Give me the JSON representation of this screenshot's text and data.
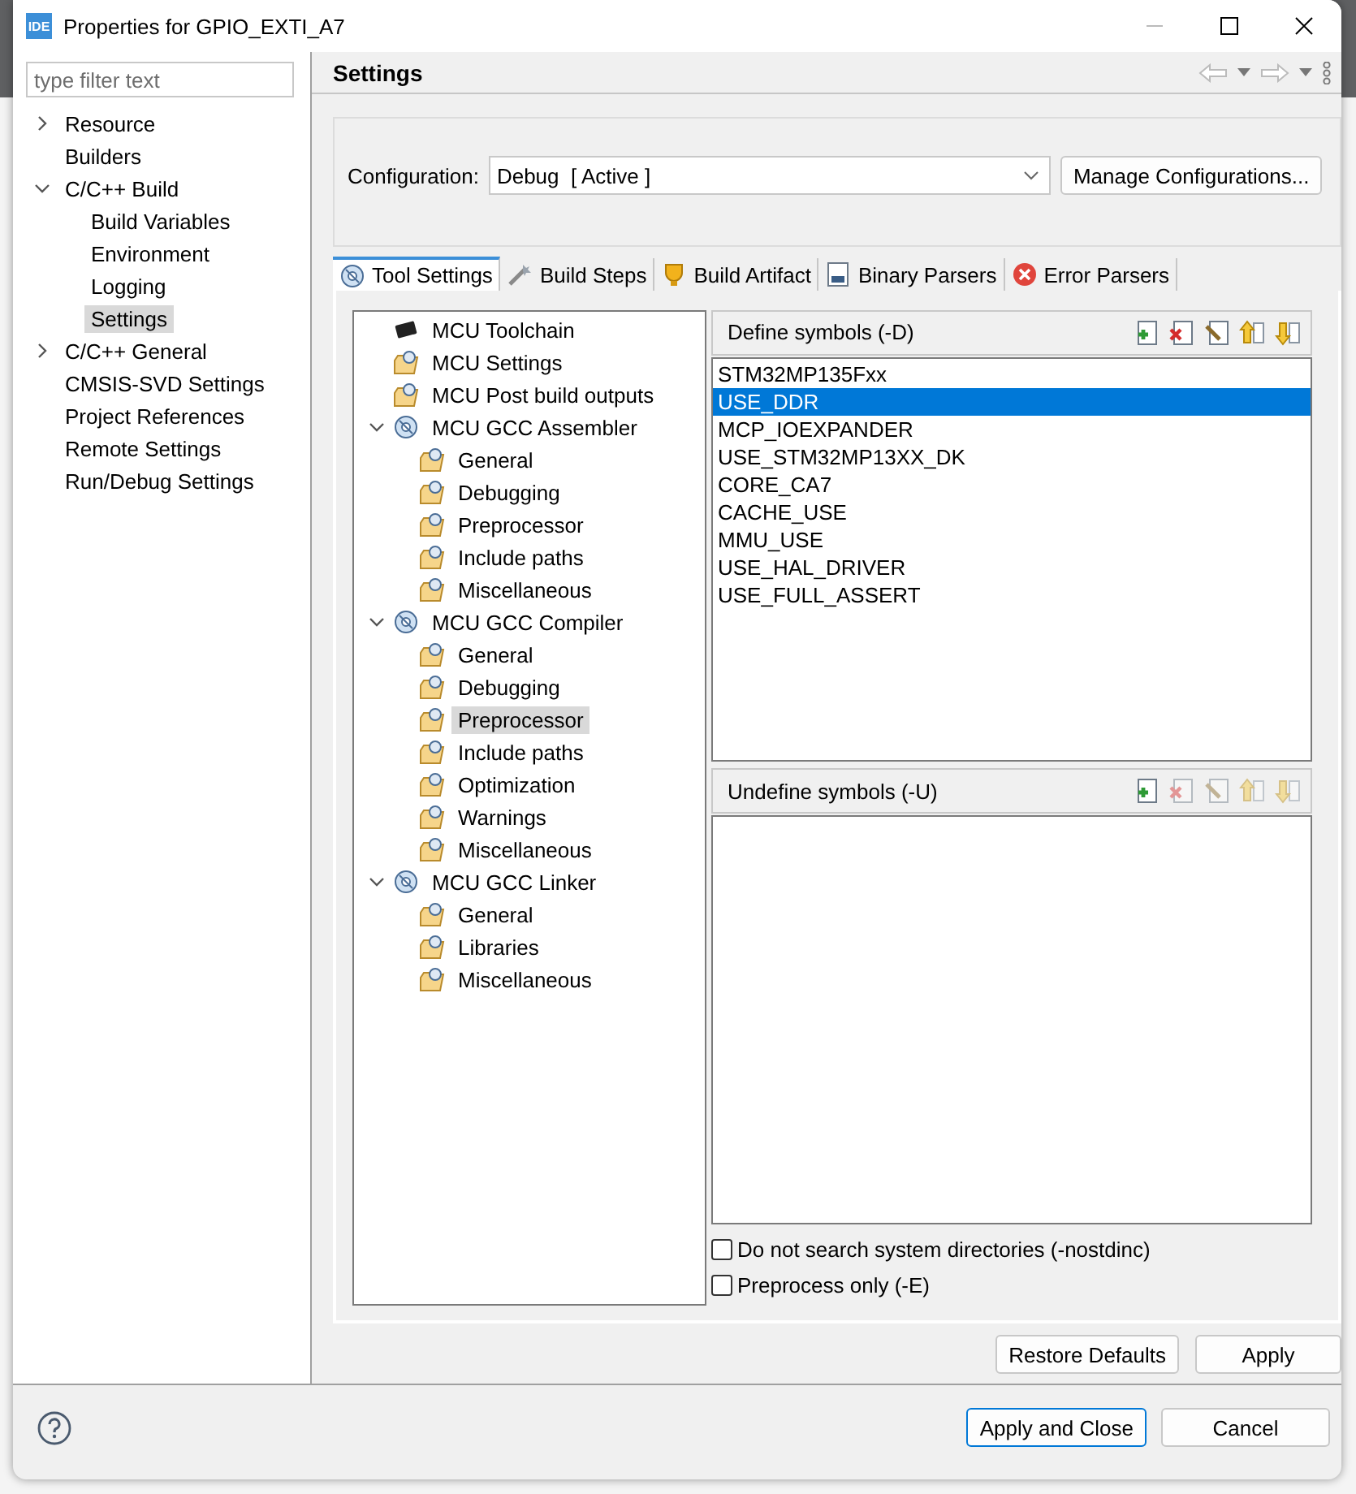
{
  "window": {
    "title": "Properties for GPIO_EXTI_A7",
    "logo": "IDE"
  },
  "filter": {
    "placeholder": "type filter text"
  },
  "nav_tree": [
    {
      "label": "Resource",
      "kind": "group",
      "expanded": false,
      "selected": false
    },
    {
      "label": "Builders",
      "kind": "leaf",
      "selected": false
    },
    {
      "label": "C/C++ Build",
      "kind": "group",
      "expanded": true,
      "selected": false,
      "children": [
        {
          "label": "Build Variables",
          "kind": "leaf",
          "selected": false
        },
        {
          "label": "Environment",
          "kind": "leaf",
          "selected": false
        },
        {
          "label": "Logging",
          "kind": "leaf",
          "selected": false
        },
        {
          "label": "Settings",
          "kind": "leaf",
          "selected": true
        }
      ]
    },
    {
      "label": "C/C++ General",
      "kind": "group",
      "expanded": false,
      "selected": false
    },
    {
      "label": "CMSIS-SVD Settings",
      "kind": "leaf",
      "selected": false
    },
    {
      "label": "Project References",
      "kind": "leaf",
      "selected": false
    },
    {
      "label": "Remote Settings",
      "kind": "leaf",
      "selected": false
    },
    {
      "label": "Run/Debug Settings",
      "kind": "leaf",
      "selected": false
    }
  ],
  "page": {
    "title": "Settings"
  },
  "configuration": {
    "label": "Configuration:",
    "value": "Debug  [ Active ]",
    "button": "Manage Configurations..."
  },
  "tabs": [
    {
      "label": "Tool Settings",
      "kind": "tool",
      "selected": true
    },
    {
      "label": "Build Steps",
      "kind": "steps",
      "selected": false
    },
    {
      "label": "Build Artifact",
      "kind": "artifact",
      "selected": false
    },
    {
      "label": "Binary Parsers",
      "kind": "binary",
      "selected": false
    },
    {
      "label": "Error Parsers",
      "kind": "error",
      "selected": false
    }
  ],
  "tool_tree": [
    {
      "label": "MCU Toolchain",
      "kind": "chip",
      "selected": false
    },
    {
      "label": "MCU Settings",
      "kind": "option",
      "selected": false
    },
    {
      "label": "MCU Post build outputs",
      "kind": "option",
      "selected": false
    },
    {
      "label": "MCU GCC Assembler",
      "kind": "tool",
      "expanded": true,
      "selected": false,
      "children": [
        {
          "label": "General",
          "kind": "option",
          "selected": false
        },
        {
          "label": "Debugging",
          "kind": "option",
          "selected": false
        },
        {
          "label": "Preprocessor",
          "kind": "option",
          "selected": false
        },
        {
          "label": "Include paths",
          "kind": "option",
          "selected": false
        },
        {
          "label": "Miscellaneous",
          "kind": "option",
          "selected": false
        }
      ]
    },
    {
      "label": "MCU GCC Compiler",
      "kind": "tool",
      "expanded": true,
      "selected": false,
      "children": [
        {
          "label": "General",
          "kind": "option",
          "selected": false
        },
        {
          "label": "Debugging",
          "kind": "option",
          "selected": false
        },
        {
          "label": "Preprocessor",
          "kind": "option",
          "selected": true
        },
        {
          "label": "Include paths",
          "kind": "option",
          "selected": false
        },
        {
          "label": "Optimization",
          "kind": "option",
          "selected": false
        },
        {
          "label": "Warnings",
          "kind": "option",
          "selected": false
        },
        {
          "label": "Miscellaneous",
          "kind": "option",
          "selected": false
        }
      ]
    },
    {
      "label": "MCU GCC Linker",
      "kind": "tool",
      "expanded": true,
      "selected": false,
      "children": [
        {
          "label": "General",
          "kind": "option",
          "selected": false
        },
        {
          "label": "Libraries",
          "kind": "option",
          "selected": false
        },
        {
          "label": "Miscellaneous",
          "kind": "option",
          "selected": false
        }
      ]
    }
  ],
  "symbol_lists": [
    {
      "title": "Define symbols (-D)",
      "toolbar": [
        {
          "kind": "add",
          "disabled": false
        },
        {
          "kind": "delete",
          "disabled": false
        },
        {
          "kind": "edit",
          "disabled": false
        },
        {
          "kind": "up",
          "disabled": false
        },
        {
          "kind": "down",
          "disabled": false
        }
      ],
      "items": [
        {
          "label": "STM32MP135Fxx",
          "selected": false
        },
        {
          "label": "USE_DDR",
          "selected": true
        },
        {
          "label": "MCP_IOEXPANDER",
          "selected": false
        },
        {
          "label": "USE_STM32MP13XX_DK",
          "selected": false
        },
        {
          "label": "CORE_CA7",
          "selected": false
        },
        {
          "label": "CACHE_USE",
          "selected": false
        },
        {
          "label": "MMU_USE",
          "selected": false
        },
        {
          "label": "USE_HAL_DRIVER",
          "selected": false
        },
        {
          "label": "USE_FULL_ASSERT",
          "selected": false
        }
      ]
    },
    {
      "title": "Undefine symbols (-U)",
      "toolbar": [
        {
          "kind": "add",
          "disabled": false
        },
        {
          "kind": "delete",
          "disabled": true
        },
        {
          "kind": "edit",
          "disabled": true
        },
        {
          "kind": "up",
          "disabled": true
        },
        {
          "kind": "down",
          "disabled": true
        }
      ]
    }
  ],
  "options": [
    {
      "label": "Do not search system directories (-nostdinc)",
      "checked": false
    },
    {
      "label": "Preprocess only (-E)",
      "checked": false
    }
  ],
  "page_buttons": [
    "Restore Defaults",
    "Apply"
  ],
  "dialog_buttons": [
    {
      "label": "Apply and Close",
      "default": true
    },
    {
      "label": "Cancel",
      "default": false
    }
  ]
}
